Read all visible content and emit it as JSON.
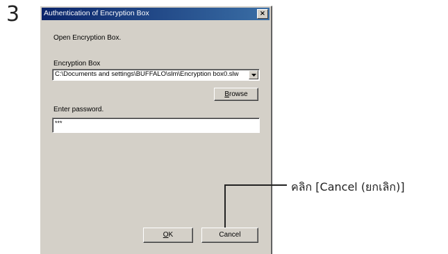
{
  "step_number": "3",
  "dialog": {
    "title": "Authentication of Encryption Box",
    "close_glyph": "×",
    "message": "Open Encryption Box.",
    "box_label": "Encryption Box",
    "box_path": "C:\\Documents and settings\\BUFFALO\\slm\\Encryption box0.slw",
    "browse_accel": "B",
    "browse_rest": "rowse",
    "password_label": "Enter password.",
    "password_value": "***",
    "ok_accel": "O",
    "ok_rest": "K",
    "cancel_label": "Cancel"
  },
  "callout": {
    "text": "คลิก [Cancel (ยกเลิก)]"
  }
}
